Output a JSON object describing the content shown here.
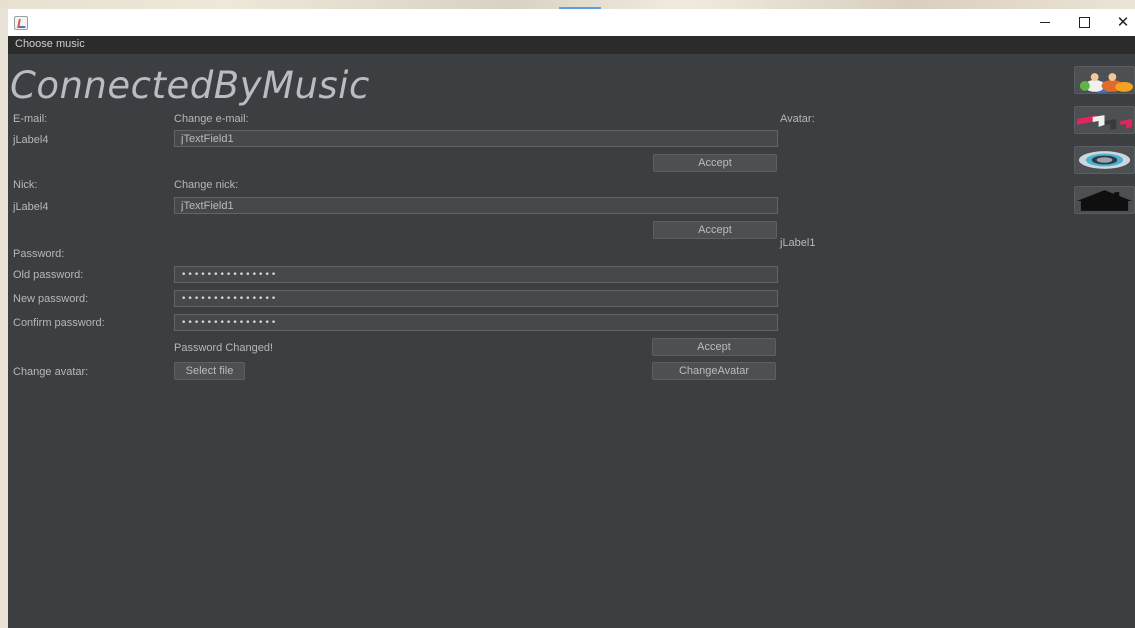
{
  "window": {
    "close_glyph": "✕"
  },
  "menu": {
    "items": [
      "Choose music"
    ]
  },
  "app_title": "ConnectedByMusic",
  "email": {
    "label": "E-mail:",
    "value_label": "jLabel4",
    "change_label": "Change e-mail:",
    "field_value": "jTextField1",
    "accept_label": "Accept"
  },
  "nick": {
    "label": "Nick:",
    "value_label": "jLabel4",
    "change_label": "Change nick:",
    "field_value": "jTextField1",
    "accept_label": "Accept"
  },
  "avatar": {
    "label": "Avatar:",
    "image_label": "jLabel1"
  },
  "password": {
    "section_label": "Password:",
    "old_label": "Old password:",
    "new_label": "New password:",
    "confirm_label": "Confirm password:",
    "old_value": "•••••••••••••••",
    "new_value": "•••••••••••••••",
    "confirm_value": "•••••••••••••••",
    "status_text": "Password Changed!",
    "accept_label": "Accept"
  },
  "change_avatar": {
    "label": "Change avatar:",
    "select_file_label": "Select file",
    "change_button_label": "ChangeAvatar"
  },
  "side_nav": {
    "icons": [
      "users-icon",
      "music-notes-icon",
      "settings-ring-icon",
      "home-icon"
    ]
  }
}
